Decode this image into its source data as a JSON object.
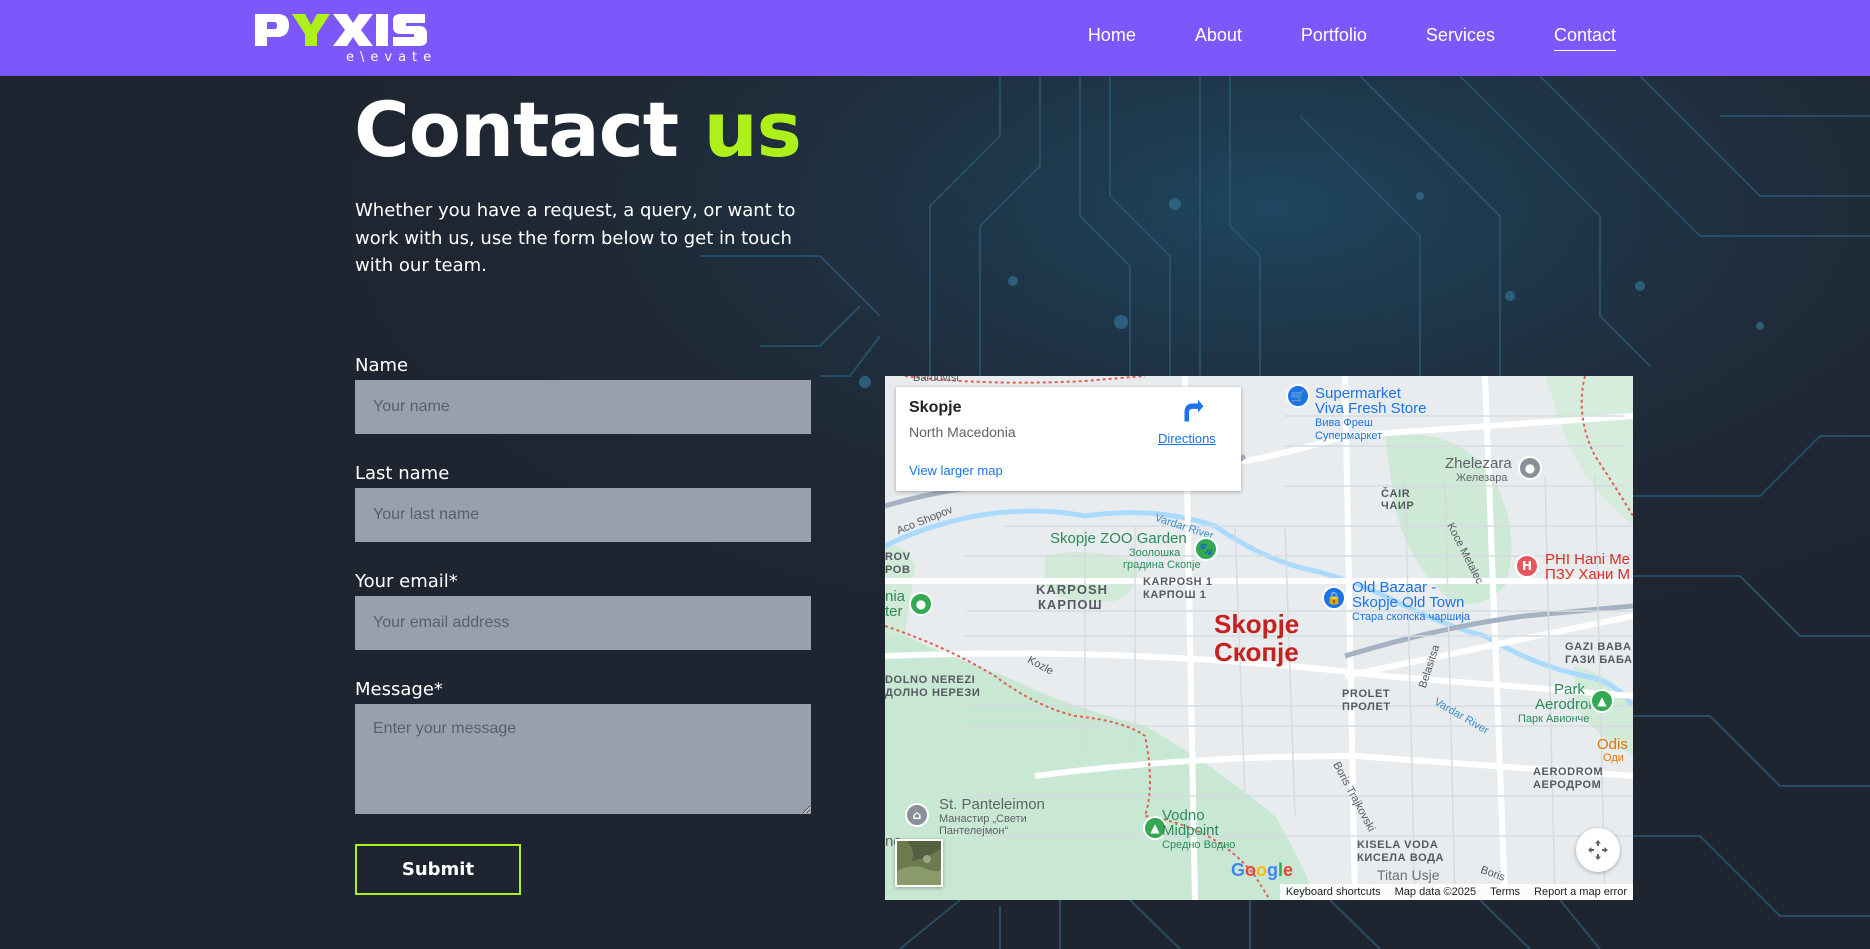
{
  "brand": {
    "logo_text": "PYXIS",
    "logo_tagline": "e\\evate",
    "primary_color": "#7c57fa",
    "accent_color": "#aef01c"
  },
  "nav": {
    "items": [
      {
        "label": "Home"
      },
      {
        "label": "About"
      },
      {
        "label": "Portfolio"
      },
      {
        "label": "Services"
      },
      {
        "label": "Contact",
        "active": true
      }
    ]
  },
  "hero": {
    "title_main": "Contact",
    "title_accent": "us",
    "intro": "Whether you have a request, a query, or want to work with us, use the form below to get in touch with our team."
  },
  "form": {
    "name": {
      "label": "Name",
      "placeholder": "Your name",
      "value": ""
    },
    "last_name": {
      "label": "Last name",
      "placeholder": "Your last name",
      "value": ""
    },
    "email": {
      "label": "Your email*",
      "placeholder": "Your email address",
      "value": ""
    },
    "message": {
      "label": "Message*",
      "placeholder": "Enter your message",
      "value": ""
    },
    "submit_label": "Submit"
  },
  "map": {
    "card": {
      "place": "Skopje",
      "country": "North Macedonia",
      "directions": "Directions",
      "view_larger": "View larger map"
    },
    "city_label_latin": "Skopje",
    "city_label_cyrillic": "Скопје",
    "labels": {
      "bardovtsi": "Bardovtsi",
      "supermarket_1": "Supermarket",
      "supermarket_2": "Viva Fresh Store",
      "supermarket_cyr_1": "Вива Фреш",
      "supermarket_cyr_2": "Супермаркет",
      "zhelezara": "Zhelezara",
      "zhelezara_cyr": "Железара",
      "chair": "ČAIR",
      "chair_cyr": "ЧАИР",
      "koce_metalec": "Koce Metalec",
      "phi_1": "PHI Hani Me",
      "phi_2": "ПЗУ Хани М",
      "vardar_river_1": "Vardar River",
      "vardar_river_2": "Vardar River",
      "aco_shopov": "Aco Shopov",
      "zoo_1": "Skopje ZOO Garden",
      "zoo_cyr_1": "Зоолошка",
      "zoo_cyr_2": "градина Скопје",
      "karposh": "KARPOSH",
      "karposh_cyr": "КАРПОШ",
      "karposh1": "KARPOSH 1",
      "karposh1_cyr": "КАРПОШ 1",
      "old_bazaar_1": "Old Bazaar -",
      "old_bazaar_2": "Skopje Old Town",
      "old_bazaar_cyr": "Стара скопска чаршија",
      "gazi_baba": "GAZI BABA",
      "gazi_baba_cyr": "ГАЗИ БАБА",
      "rov": "ROV",
      "rov_cyr": "РОВ",
      "nia": "nia",
      "ter": "ter",
      "kozle": "Kozle",
      "dolno_nerezi": "DOLNO NEREZI",
      "dolno_nerezi_cyr": "ДОЛНО НЕРЕЗИ",
      "prolet": "PROLET",
      "prolet_cyr": "ПРОЛЕТ",
      "belasitsa": "Belasitsa",
      "park_1": "Park",
      "park_2": "Aerodrom",
      "park_cyr": "Парк Авионче",
      "odis": "Odis",
      "odis_cyr": "Оди",
      "aerodrom": "AERODROM",
      "aerodrom_cyr": "АЕРОДРОМ",
      "boris_trajkovski": "Boris Trajkovski",
      "panteleimon_1": "St. Panteleimon",
      "panteleimon_cyr_1": "Манастир „Свети",
      "panteleimon_cyr_2": "Пантелејмон“",
      "vodno_1": "Vodno",
      "vodno_2": "Midpoint",
      "vodno_cyr": "Средно Водно",
      "kisela_voda": "KISELA VODA",
      "kisela_voda_cyr": "КИСЕЛА ВОДА",
      "titan_usje": "Titan Usje",
      "boris_2": "Boris",
      "no": "no"
    },
    "attribution": {
      "shortcuts": "Keyboard shortcuts",
      "map_data": "Map data ©2025",
      "terms": "Terms",
      "report": "Report a map error"
    }
  }
}
